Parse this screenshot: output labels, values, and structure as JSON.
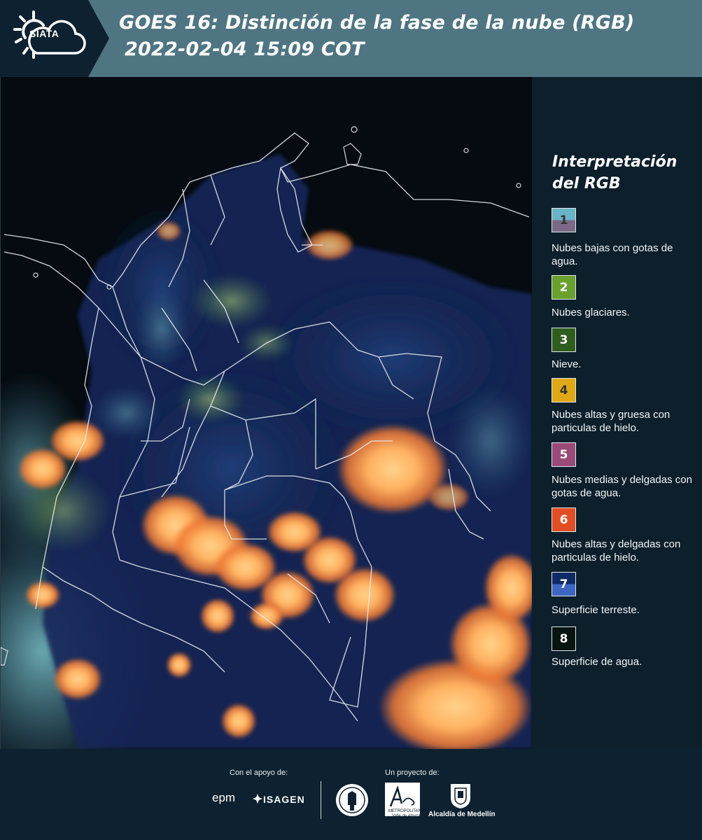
{
  "header": {
    "logo_text": "SIATA",
    "title_line1": "GOES 16: Distinción de la fase de la nube (RGB)",
    "title_line2": "2022-02-04 15:09 COT"
  },
  "legend": {
    "title_line1": "Interpretación",
    "title_line2": "del RGB",
    "items": [
      {
        "number": "1",
        "label": "Nubes bajas con gotas de agua.",
        "color_top": "#6bb3c6",
        "color_bottom": "#7a6a85",
        "number_color": "#333333"
      },
      {
        "number": "2",
        "label": "Nubes glaciares.",
        "color_top": "#6aa12e",
        "color_bottom": "#6aa12e",
        "number_color": "#ffffff"
      },
      {
        "number": "3",
        "label": "Nieve.",
        "color_top": "#2f5d1e",
        "color_bottom": "#2f5d1e",
        "number_color": "#ffffff"
      },
      {
        "number": "4",
        "label": "Nubes altas y gruesa con particulas de hielo.",
        "color_top": "#e0a817",
        "color_bottom": "#e0a817",
        "number_color": "#333333"
      },
      {
        "number": "5",
        "label": "Nubes medias y delgadas con gotas de agua.",
        "color_top": "#9a4a78",
        "color_bottom": "#9a4a78",
        "number_color": "#ffffff"
      },
      {
        "number": "6",
        "label": "Nubes altas y delgadas con particulas de hielo.",
        "color_top": "#e24e24",
        "color_bottom": "#e24e24",
        "number_color": "#ffffff"
      },
      {
        "number": "7",
        "label": "Superficie terreste.",
        "color_top": "#0f2a66",
        "color_bottom": "#3d67c2",
        "number_color": "#ffffff"
      },
      {
        "number": "8",
        "label": "Superficie de agua.",
        "color_top": "#081410",
        "color_bottom": "#081410",
        "number_color": "#ffffff"
      }
    ]
  },
  "footer": {
    "support_label": "Con el apoyo de:",
    "project_label": "Un proyecto de:",
    "sponsor_epm": "epm",
    "sponsor_isagen": "ISAGEN",
    "metro_text_1": "METROPOLITANA",
    "metro_text_2": "Valle de Aburrá",
    "alcaldia": "Alcaldía de Medellín"
  }
}
